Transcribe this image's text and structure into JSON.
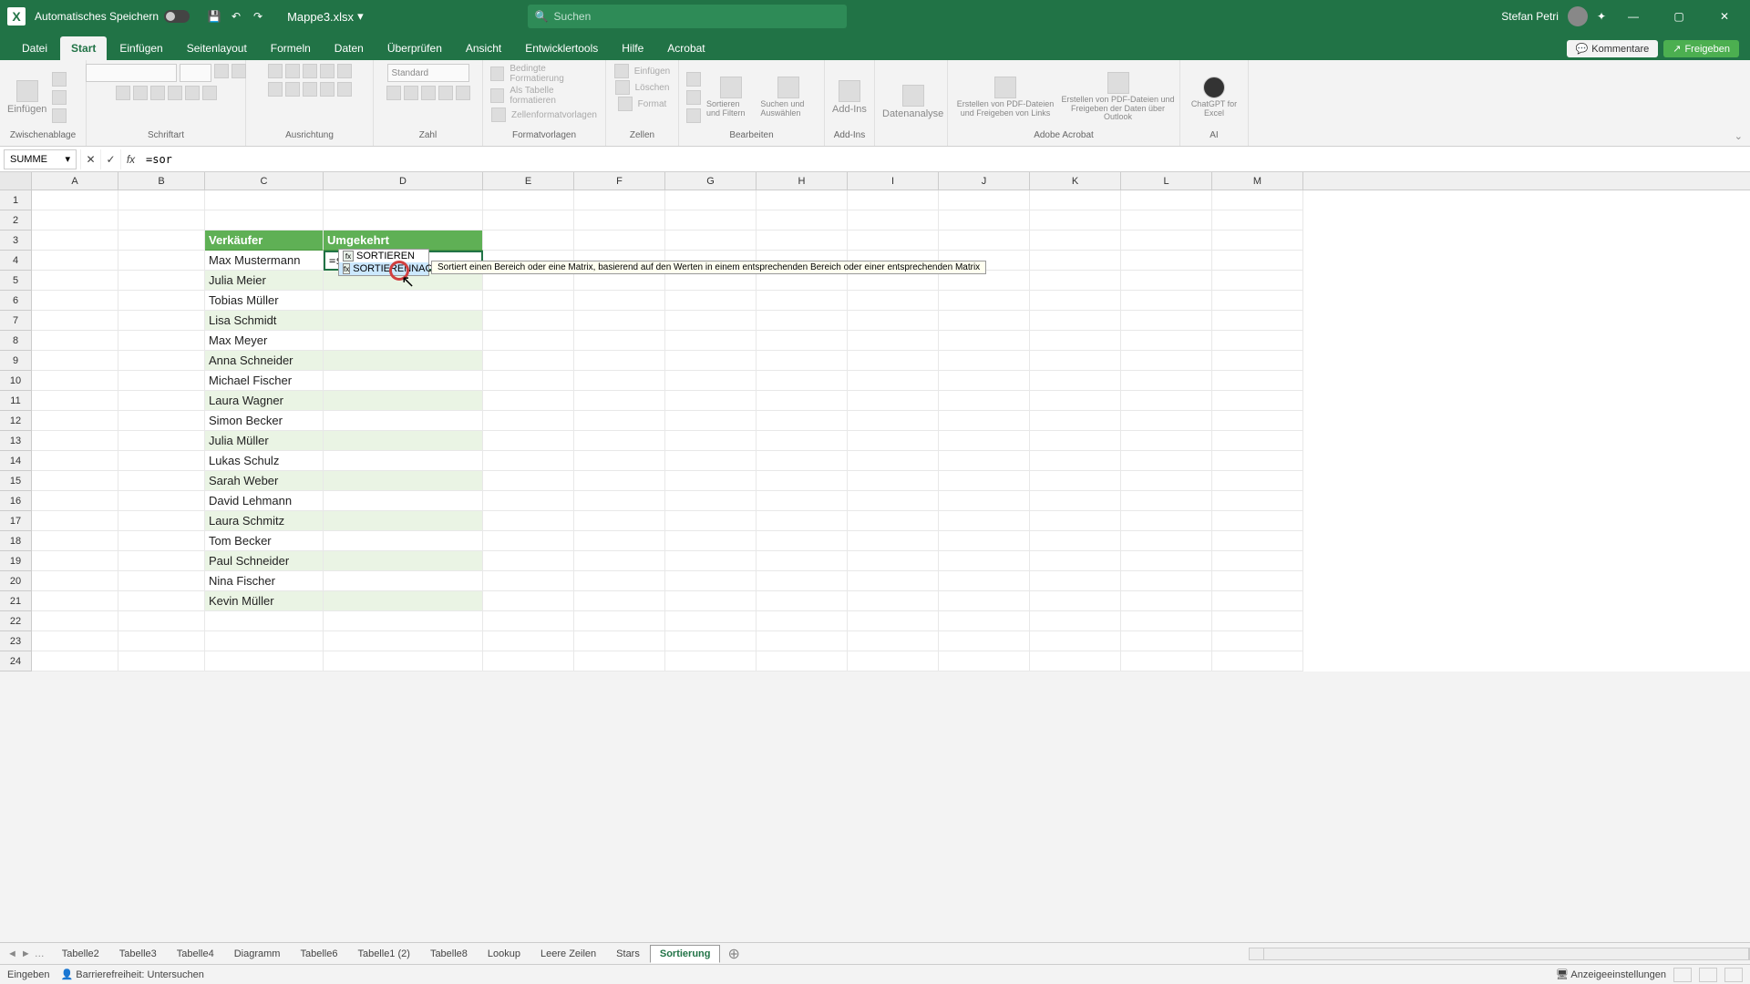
{
  "titlebar": {
    "autosave_label": "Automatisches Speichern",
    "doc_name": "Mappe3.xlsx",
    "search_placeholder": "Suchen",
    "user_name": "Stefan Petri"
  },
  "tabs": {
    "datei": "Datei",
    "start": "Start",
    "einfuegen": "Einfügen",
    "seitenlayout": "Seitenlayout",
    "formeln": "Formeln",
    "daten": "Daten",
    "ueberpruefen": "Überprüfen",
    "ansicht": "Ansicht",
    "entwicklertools": "Entwicklertools",
    "hilfe": "Hilfe",
    "acrobat": "Acrobat",
    "kommentare": "Kommentare",
    "freigeben": "Freigeben"
  },
  "ribbon": {
    "einfuegen": "Einfügen",
    "zwischenablage": "Zwischenablage",
    "schriftart": "Schriftart",
    "ausrichtung": "Ausrichtung",
    "zahl": "Zahl",
    "formatvorlagen": "Formatvorlagen",
    "zellen": "Zellen",
    "bearbeiten": "Bearbeiten",
    "addins": "Add-Ins",
    "datenanalyse": "Datenanalyse",
    "adobe": "Adobe Acrobat",
    "ki": "AI",
    "bedingte": "Bedingte Formatierung",
    "als_tabelle": "Als Tabelle formatieren",
    "zellenfmt": "Zellenformatvorlagen",
    "z_einfuegen": "Einfügen",
    "z_loeschen": "Löschen",
    "z_format": "Format",
    "sortieren": "Sortieren und Filtern",
    "suchen": "Suchen und Auswählen",
    "addins_btn": "Add-Ins",
    "analyse": "Datenanalyse",
    "pdf1": "Erstellen von PDF-Dateien und Freigeben von Links",
    "pdf2": "Erstellen von PDF-Dateien und Freigeben der Daten über Outlook",
    "chatgpt": "ChatGPT for Excel",
    "num_standard": "Standard"
  },
  "namebox": {
    "value": "SUMME"
  },
  "formula": {
    "text": "=sor"
  },
  "columns": [
    "A",
    "B",
    "C",
    "D",
    "E",
    "F",
    "G",
    "H",
    "I",
    "J",
    "K",
    "L",
    "M"
  ],
  "headers": {
    "c": "Verkäufer",
    "d": "Umgekehrt"
  },
  "sellers": [
    "Max Mustermann",
    "Julia Meier",
    "Tobias Müller",
    "Lisa Schmidt",
    "Max Meyer",
    "Anna Schneider",
    "Michael Fischer",
    "Laura Wagner",
    "Simon Becker",
    "Julia Müller",
    "Lukas Schulz",
    "Sarah Weber",
    "David Lehmann",
    "Laura Schmitz",
    "Tom Becker",
    "Paul Schneider",
    "Nina Fischer",
    "Kevin Müller"
  ],
  "active_formula": "=sor",
  "autocomplete": {
    "opt1": "SORTIEREN",
    "opt2": "SORTIERENNACH",
    "tip": "Sortiert einen Bereich oder eine Matrix, basierend auf den Werten in einem entsprechenden Bereich oder einer entsprechenden Matrix"
  },
  "sheets": [
    "Tabelle2",
    "Tabelle3",
    "Tabelle4",
    "Diagramm",
    "Tabelle6",
    "Tabelle1 (2)",
    "Tabelle8",
    "Lookup",
    "Leere Zeilen",
    "Stars",
    "Sortierung"
  ],
  "status": {
    "mode": "Eingeben",
    "access": "Barrierefreiheit: Untersuchen",
    "display": "Anzeigeeinstellungen"
  }
}
